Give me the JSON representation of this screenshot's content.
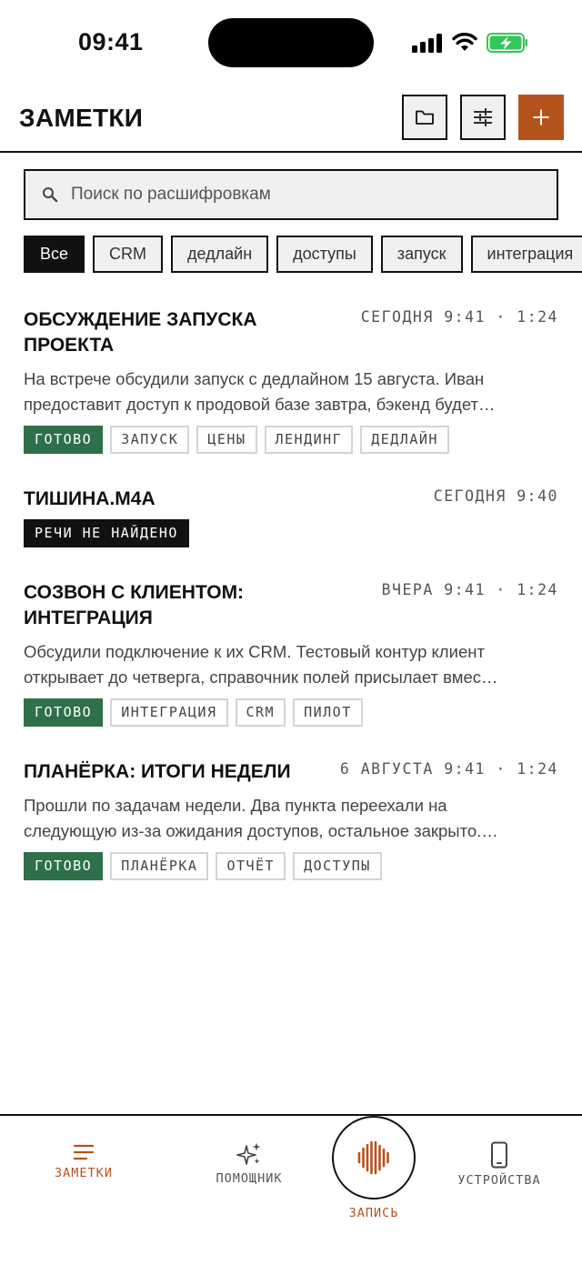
{
  "status_bar": {
    "time": "09:41"
  },
  "header": {
    "title": "ЗАМЕТКИ"
  },
  "search": {
    "placeholder": "Поиск по расшифровкам"
  },
  "filters": [
    "Все",
    "CRM",
    "дедлайн",
    "доступы",
    "запуск",
    "интеграция"
  ],
  "notes": [
    {
      "title_lines": [
        "ОБСУЖДЕНИЕ ЗАПУСКА",
        "ПРОЕКТА"
      ],
      "meta": "СЕГОДНЯ 9:41 · 1:24",
      "text_lines": [
        "На встрече обсудили запуск с дедлайном 15 августа. Иван",
        "предоставит доступ к продовой базе завтра, бэкенд будет…"
      ],
      "status": "ГОТОВО",
      "tags": [
        "ЗАПУСК",
        "ЦЕНЫ",
        "ЛЕНДИНГ",
        "ДЕДЛАЙН"
      ]
    },
    {
      "title_lines": [
        "ТИШИНА.M4A"
      ],
      "meta": "СЕГОДНЯ 9:40",
      "status": "РЕЧИ НЕ НАЙДЕНО"
    },
    {
      "title_lines": [
        "СОЗВОН С КЛИЕНТОМ:",
        "ИНТЕГРАЦИЯ"
      ],
      "meta": "ВЧЕРА 9:41 · 1:24",
      "text_lines": [
        "Обсудили подключение к их CRM. Тестовый контур клиент",
        "открывает до четверга, справочник полей присылает вмес…"
      ],
      "status": "ГОТОВО",
      "tags": [
        "ИНТЕГРАЦИЯ",
        "CRM",
        "ПИЛОТ"
      ]
    },
    {
      "title_lines": [
        "ПЛАНЁРКА: ИТОГИ НЕДЕЛИ"
      ],
      "meta": "6 АВГУСТА 9:41 · 1:24",
      "text_lines": [
        "Прошли по задачам недели. Два пункта переехали на",
        "следующую из-за ожидания доступов, остальное закрыто.…"
      ],
      "status": "ГОТОВО",
      "tags": [
        "ПЛАНЁРКА",
        "ОТЧЁТ",
        "ДОСТУПЫ"
      ]
    }
  ],
  "tabbar": {
    "notes": "ЗАМЕТКИ",
    "assistant": "ПОМОЩНИК",
    "record": "ЗАПИСЬ",
    "devices": "УСТРОЙСТВА"
  },
  "colors": {
    "accent": "#b5531d",
    "done": "#2e7049",
    "ink": "#111111",
    "battery": "#34c759"
  },
  "icons": [
    "folder-icon",
    "sliders-icon",
    "plus-icon",
    "search-icon",
    "lines-icon",
    "sparkles-icon",
    "waveform-icon",
    "phone-icon"
  ]
}
